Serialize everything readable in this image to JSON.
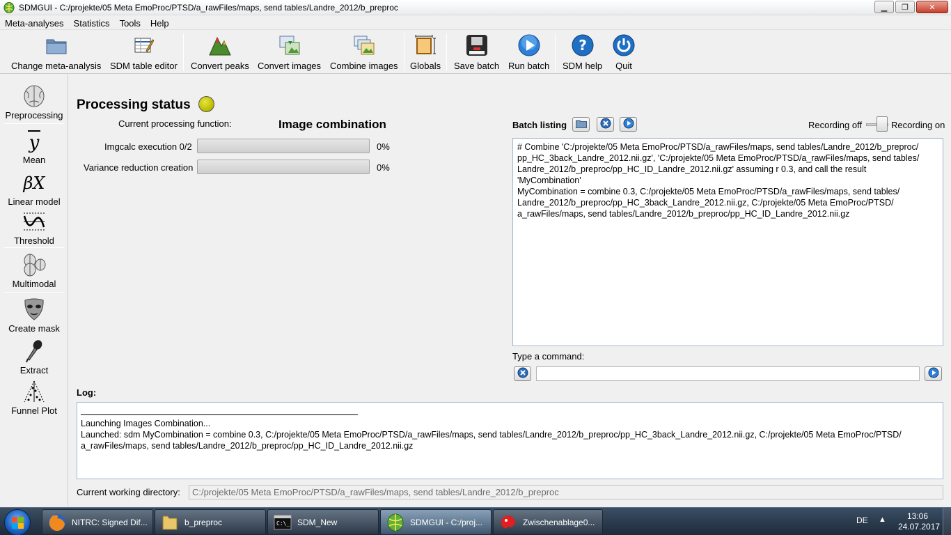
{
  "window": {
    "title": "SDMGUI - C:/projekte/05 Meta EmoProc/PTSD/a_rawFiles/maps, send tables/Landre_2012/b_preproc",
    "minimize": "▁",
    "maximize": "❐",
    "close": "✕"
  },
  "menu": [
    "Meta-analyses",
    "Statistics",
    "Tools",
    "Help"
  ],
  "toolbar": {
    "change_meta": "Change meta-analysis",
    "sdm_table_editor": "SDM table editor",
    "convert_peaks": "Convert peaks",
    "convert_images": "Convert images",
    "combine_images": "Combine images",
    "globals": "Globals",
    "save_batch": "Save batch",
    "run_batch": "Run batch",
    "sdm_help": "SDM help",
    "quit": "Quit"
  },
  "sidebar": {
    "preprocessing": "Preprocessing",
    "mean": "Mean",
    "linear_model": "Linear model",
    "threshold": "Threshold",
    "multimodal": "Multimodal",
    "create_mask": "Create mask",
    "extract": "Extract",
    "funnel_plot": "Funnel Plot"
  },
  "processing": {
    "title": "Processing status",
    "status_color": "#c8c800",
    "current_function_label": "Current processing function:",
    "current_function_value": "Image combination",
    "imgcalc_label": "Imgcalc execution  0/2",
    "imgcalc_progress": 0,
    "imgcalc_pct": "0%",
    "variance_label": "Variance reduction creation",
    "variance_progress": 0,
    "variance_pct": "0%"
  },
  "batch": {
    "label": "Batch listing",
    "recording_off": "Recording off",
    "recording_on": "Recording on",
    "lines": [
      "# Combine 'C:/projekte/05 Meta EmoProc/PTSD/a_rawFiles/maps, send tables/Landre_2012/b_preproc/",
      "pp_HC_3back_Landre_2012.nii.gz', 'C:/projekte/05 Meta EmoProc/PTSD/a_rawFiles/maps, send tables/",
      "Landre_2012/b_preproc/pp_HC_ID_Landre_2012.nii.gz' assuming r 0.3, and call the result",
      "'MyCombination'",
      "MyCombination = combine 0.3, C:/projekte/05 Meta EmoProc/PTSD/a_rawFiles/maps, send tables/",
      "Landre_2012/b_preproc/pp_HC_3back_Landre_2012.nii.gz, C:/projekte/05 Meta EmoProc/PTSD/",
      "a_rawFiles/maps, send tables/Landre_2012/b_preproc/pp_HC_ID_Landre_2012.nii.gz"
    ]
  },
  "command": {
    "label": "Type a command:",
    "value": ""
  },
  "log": {
    "label": "Log:",
    "lines": [
      "Launching Images Combination...",
      "Launched: sdm MyCombination = combine 0.3, C:/projekte/05 Meta EmoProc/PTSD/a_rawFiles/maps, send tables/Landre_2012/b_preproc/pp_HC_3back_Landre_2012.nii.gz, C:/projekte/05 Meta EmoProc/PTSD/",
      "a_rawFiles/maps, send tables/Landre_2012/b_preproc/pp_HC_ID_Landre_2012.nii.gz"
    ]
  },
  "cwd": {
    "label": "Current working directory:",
    "value": "C:/projekte/05 Meta EmoProc/PTSD/a_rawFiles/maps, send tables/Landre_2012/b_preproc"
  },
  "taskbar": {
    "items": [
      {
        "label": "NITRC: Signed Dif...",
        "icon": "firefox-icon"
      },
      {
        "label": "b_preproc",
        "icon": "folder-icon"
      },
      {
        "label": "SDM_New",
        "icon": "console-icon"
      },
      {
        "label": "SDMGUI - C:/proj...",
        "icon": "sdm-brain-icon",
        "active": true
      },
      {
        "label": "Zwischenablage0...",
        "icon": "paint-icon"
      }
    ],
    "lang": "DE",
    "tray_arrow": "▲",
    "time": "13:06",
    "date": "24.07.2017"
  }
}
